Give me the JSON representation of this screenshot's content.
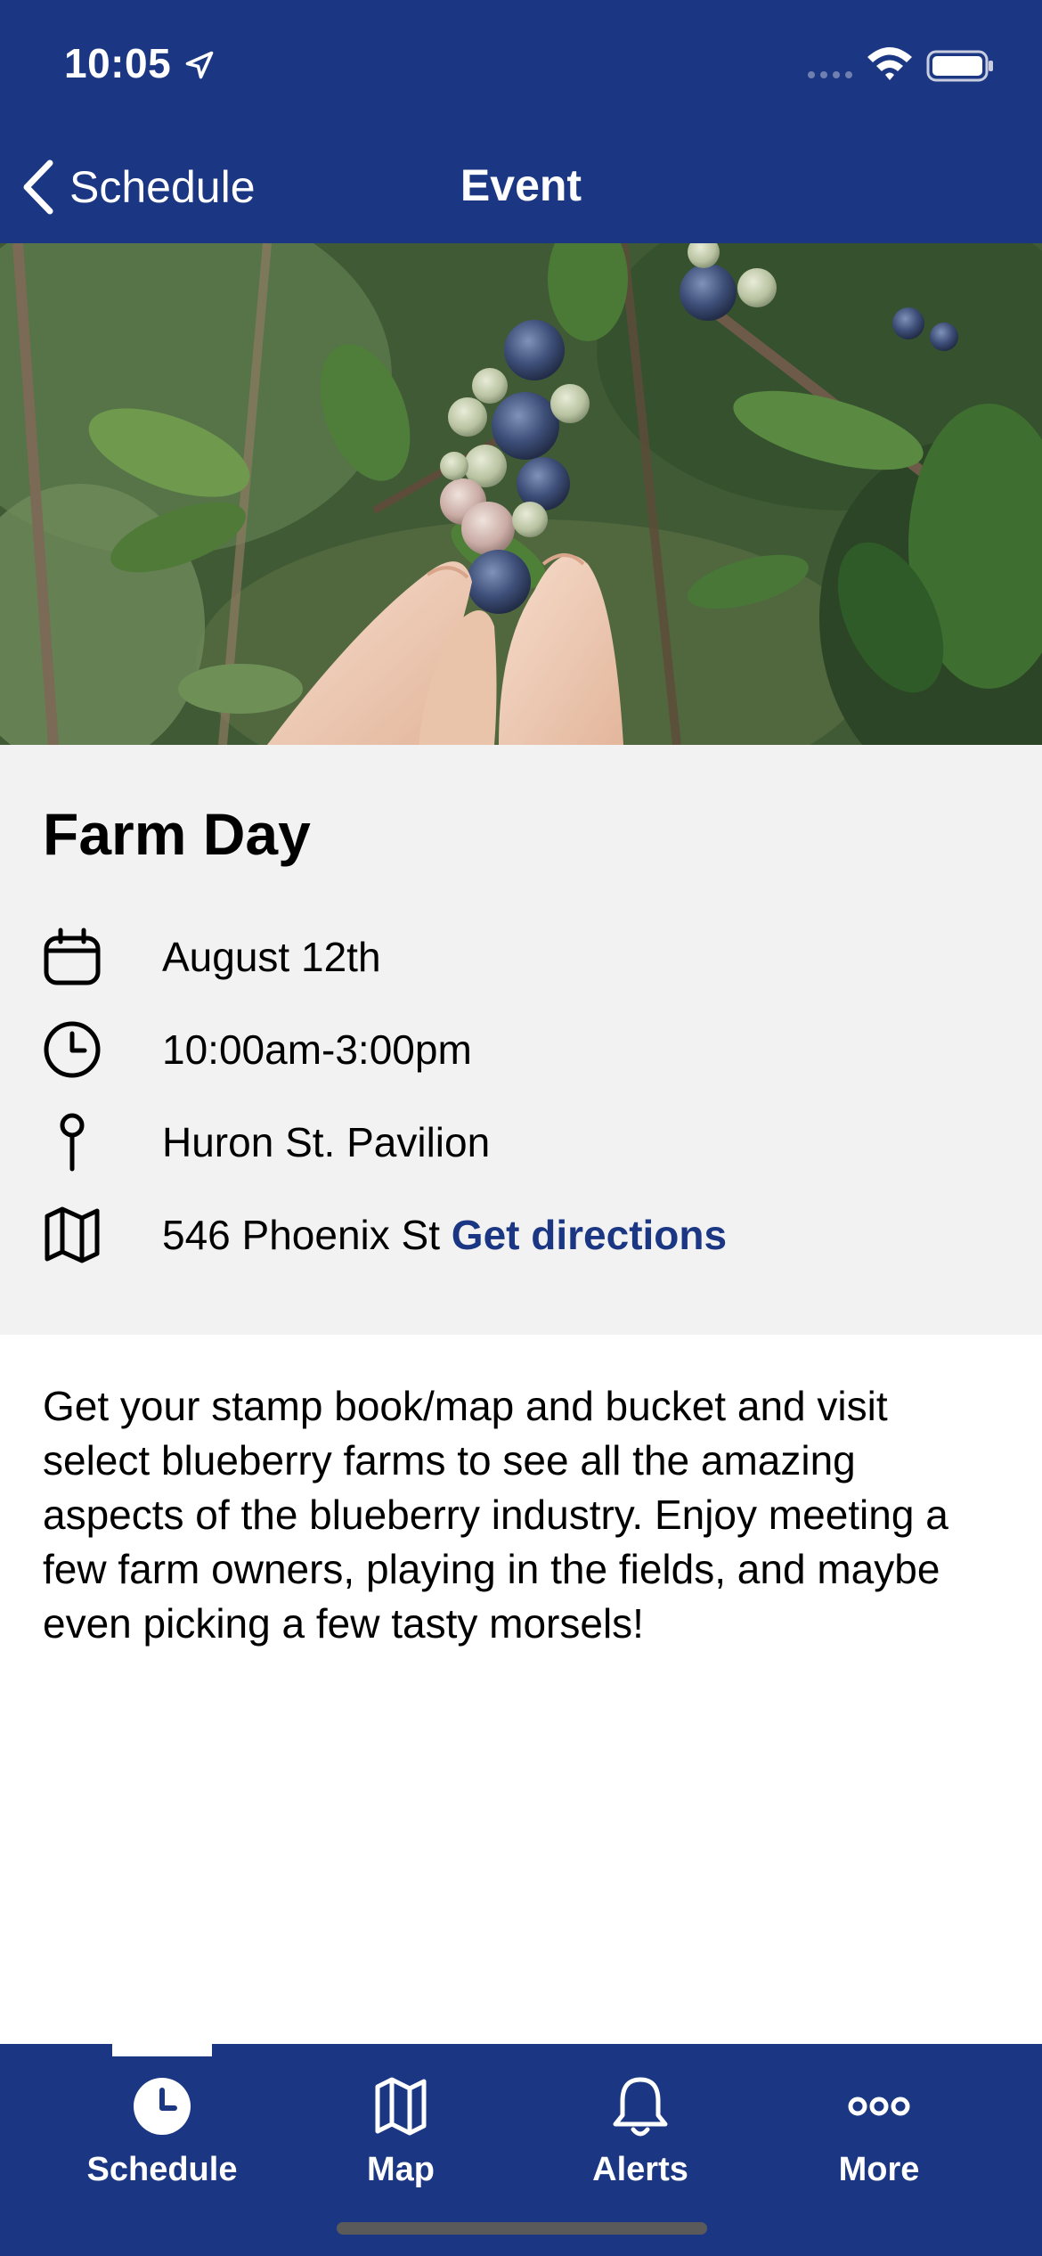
{
  "status_bar": {
    "time": "10:05"
  },
  "nav": {
    "back_label": "Schedule",
    "title": "Event"
  },
  "hero": {
    "alt": "Hand picking blueberries"
  },
  "event": {
    "title": "Farm Day",
    "date": "August 12th",
    "time": "10:00am-3:00pm",
    "location": "Huron St. Pavilion",
    "address": "546 Phoenix St",
    "directions_link": "Get directions",
    "description": "Get your stamp book/map and bucket and visit select blueberry farms to see all the amazing aspects of the blueberry industry. Enjoy meeting a few farm owners, playing in the fields, and maybe even picking a few tasty morsels!"
  },
  "tabs": [
    {
      "label": "Schedule",
      "icon": "clock-icon",
      "selected": true
    },
    {
      "label": "Map",
      "icon": "map-icon",
      "selected": false
    },
    {
      "label": "Alerts",
      "icon": "bell-icon",
      "selected": false
    },
    {
      "label": "More",
      "icon": "more-icon",
      "selected": false
    }
  ],
  "colors": {
    "brand": "#1b3783",
    "panel": "#f2f2f2",
    "link": "#1b3783"
  }
}
